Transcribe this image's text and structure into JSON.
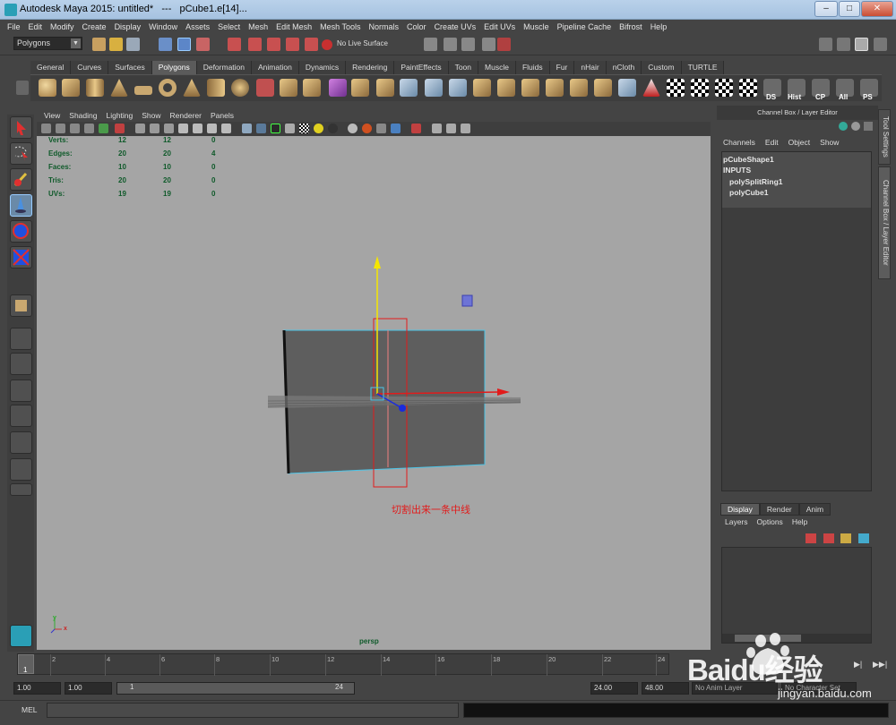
{
  "window": {
    "title": "Autodesk Maya 2015: untitled*   ---   pCube1.e[14]..."
  },
  "menubar": [
    "File",
    "Edit",
    "Modify",
    "Create",
    "Display",
    "Window",
    "Assets",
    "Select",
    "Mesh",
    "Edit Mesh",
    "Mesh Tools",
    "Normals",
    "Color",
    "Create UVs",
    "Edit UVs",
    "Muscle",
    "Pipeline Cache",
    "Bifrost",
    "Help"
  ],
  "statusline": {
    "menu_set": "Polygons",
    "live_surface": "No Live Surface"
  },
  "shelf_tabs": [
    "General",
    "Curves",
    "Surfaces",
    "Polygons",
    "Deformation",
    "Animation",
    "Dynamics",
    "Rendering",
    "PaintEffects",
    "Toon",
    "Muscle",
    "Fluids",
    "Fur",
    "nHair",
    "nCloth",
    "Custom",
    "TURTLE"
  ],
  "shelf_active": "Polygons",
  "shelf_labels": [
    "DS",
    "Hist",
    "CP",
    "All",
    "PS"
  ],
  "panel_menu": [
    "View",
    "Shading",
    "Lighting",
    "Show",
    "Renderer",
    "Panels"
  ],
  "hud": {
    "rows": [
      {
        "label": "Verts:",
        "a": "12",
        "b": "12",
        "c": "0"
      },
      {
        "label": "Edges:",
        "a": "20",
        "b": "20",
        "c": "4"
      },
      {
        "label": "Faces:",
        "a": "10",
        "b": "10",
        "c": "0"
      },
      {
        "label": "Tris:",
        "a": "20",
        "b": "20",
        "c": "0"
      },
      {
        "label": "UVs:",
        "a": "19",
        "b": "19",
        "c": "0"
      }
    ]
  },
  "viewport": {
    "camera": "persp",
    "annotation": "切割出来一条中线",
    "axis_x": "x",
    "axis_y": "y"
  },
  "channel_box": {
    "header": "Channel Box / Layer Editor",
    "menu": [
      "Channels",
      "Edit",
      "Object",
      "Show"
    ],
    "node": "pCubeShape1",
    "inputs_label": "INPUTS",
    "inputs": [
      "polySplitRing1",
      "polyCube1"
    ]
  },
  "side_tabs": [
    "Tool Settings",
    "Channel Box / Layer Editor"
  ],
  "layer_editor": {
    "tabs": [
      "Display",
      "Render",
      "Anim"
    ],
    "active_tab": "Display",
    "menu": [
      "Layers",
      "Options",
      "Help"
    ]
  },
  "timeline": {
    "current": "1",
    "ticks": [
      "2",
      "4",
      "6",
      "8",
      "10",
      "12",
      "14",
      "16",
      "18",
      "20",
      "22",
      "24"
    ]
  },
  "range": {
    "start": "1.00",
    "playback_start": "1.00",
    "slider_start": "1",
    "slider_end": "24",
    "playback_end": "24.00",
    "end": "48.00",
    "anim_layer": "No Anim Layer",
    "char_set": "No Character Set"
  },
  "command_line": {
    "label": "MEL"
  },
  "watermark": {
    "brand": "Baidu经验",
    "url": "jingyan.baidu.com"
  },
  "colors": {
    "viewport_bg": "#a5a5a5",
    "mesh": "#5e5e5e",
    "selection": "#4cc5e8",
    "y_axis": "#f5e600",
    "x_axis": "#e21b1b",
    "z_axis": "#1a2bdd",
    "annotation": "#e21b1b"
  }
}
